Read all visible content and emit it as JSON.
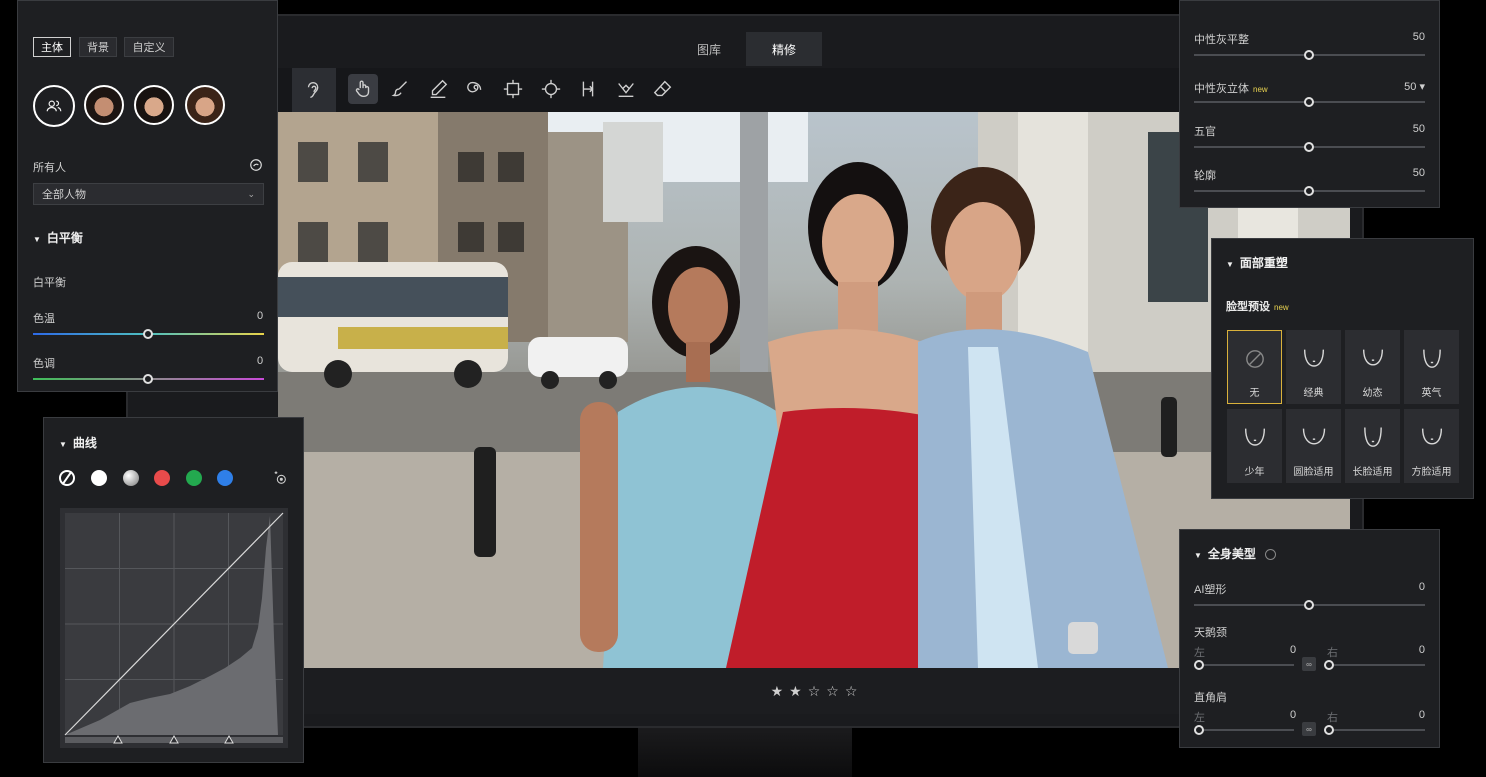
{
  "colors": {
    "panel_bg": "#1e1f22",
    "accent_selected": "#d9b13b",
    "badge_new": "#e8d250"
  },
  "tabs": [
    {
      "label": "图库"
    },
    {
      "label": "精修"
    }
  ],
  "toolbar": {
    "tools": [
      "ear-icon",
      "hand-icon",
      "brush-icon",
      "pen-icon",
      "swirl-icon",
      "transform-icon",
      "target-icon",
      "split-icon",
      "stamp-icon",
      "eraser-icon"
    ]
  },
  "rating": {
    "stars": [
      "★",
      "★",
      "☆",
      "☆",
      "☆"
    ],
    "filled": 2
  },
  "left_panel": {
    "segments": [
      "主体",
      "背景",
      "自定义"
    ],
    "people_label": "所有人",
    "people_dropdown": "全部人物",
    "wb_header": "白平衡",
    "wb_label": "白平衡",
    "temp": {
      "label": "色温",
      "value": "0",
      "level": 0.5
    },
    "tint": {
      "label": "色调",
      "value": "0",
      "level": 0.5
    }
  },
  "curves": {
    "header": "曲线",
    "channels": [
      {
        "name": "none",
        "color": "#ffffff"
      },
      {
        "name": "white",
        "color": "#ffffff"
      },
      {
        "name": "gray",
        "color": "#9a9a9a"
      },
      {
        "name": "red",
        "color": "#e84b4b"
      },
      {
        "name": "green",
        "color": "#23a94f"
      },
      {
        "name": "blue",
        "color": "#2f7fe8"
      }
    ]
  },
  "neutral_panel": {
    "rows": [
      {
        "label": "中性灰平整",
        "value": "50",
        "badge": "",
        "level": 0.5
      },
      {
        "label": "中性灰立体",
        "value": "50 ▾",
        "badge": "new",
        "level": 0.5
      },
      {
        "label": "五官",
        "value": "50",
        "badge": "",
        "level": 0.5
      },
      {
        "label": "轮廓",
        "value": "50",
        "badge": "",
        "level": 0.5
      }
    ]
  },
  "face_panel": {
    "header": "面部重塑",
    "preset_label": "脸型预设",
    "preset_badge": "new",
    "presets": [
      "无",
      "经典",
      "幼态",
      "英气",
      "少年",
      "圆脸适用",
      "长脸适用",
      "方脸适用"
    ]
  },
  "body_panel": {
    "header": "全身美型",
    "ai": {
      "label": "AI塑形",
      "value": "0",
      "level": 0.5
    },
    "swan": {
      "label": "天鹅颈",
      "left_label": "左",
      "left_value": "0",
      "right_label": "右",
      "right_value": "0"
    },
    "shoulder": {
      "label": "直角肩",
      "left_label": "左",
      "left_value": "0",
      "right_label": "右",
      "right_value": "0"
    }
  }
}
